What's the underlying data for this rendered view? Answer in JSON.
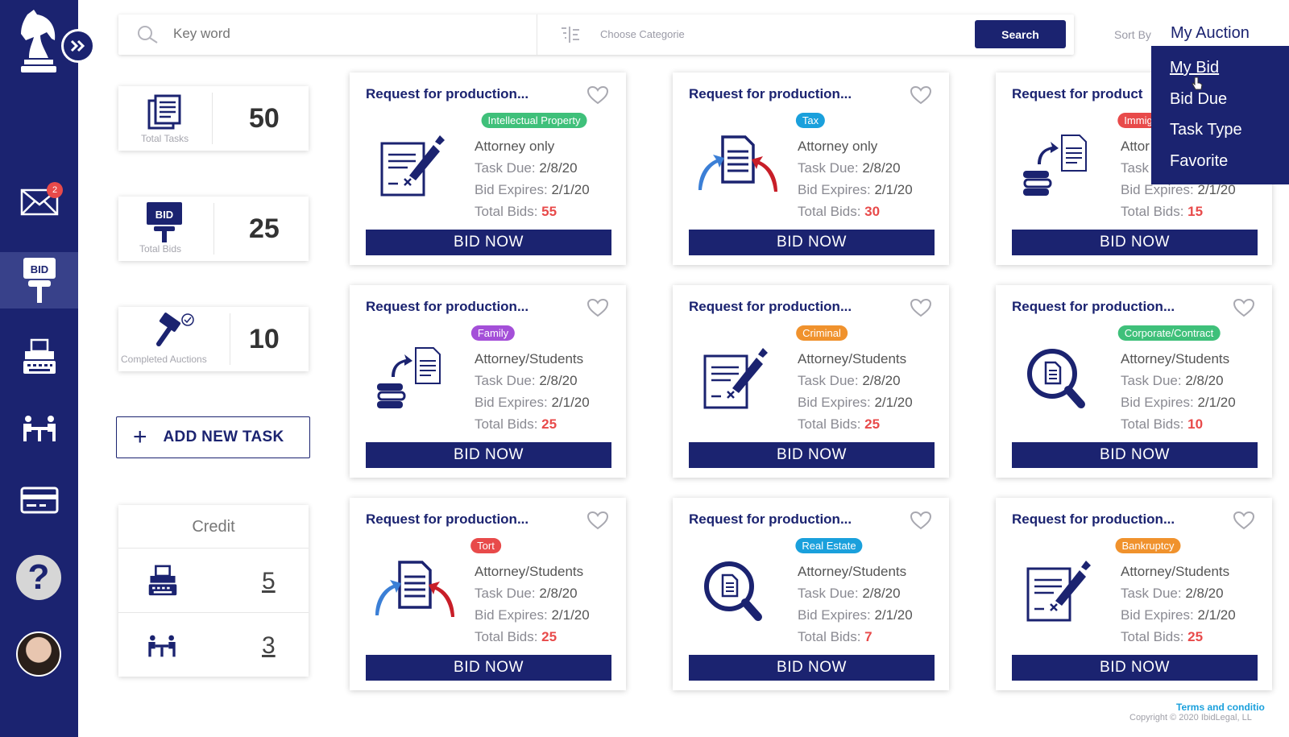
{
  "search": {
    "placeholder": "Key word",
    "category_placeholder": "Choose Categorie",
    "button": "Search"
  },
  "sort": {
    "label": "Sort By",
    "value": "My Auction",
    "options": [
      "My Bid",
      "Bid Due",
      "Task Type",
      "Favorite"
    ]
  },
  "sidebar": {
    "mail_badge": "2",
    "bid_label": "BID"
  },
  "stats": [
    {
      "label": "Total Tasks",
      "value": "50"
    },
    {
      "label": "Total Bids",
      "value": "25",
      "icon_text": "BID"
    },
    {
      "label": "Completed Auctions",
      "value": "10"
    }
  ],
  "add_task": "ADD NEW TASK",
  "credit": {
    "title": "Credit",
    "typewriter_value": "5",
    "meeting_value": "3"
  },
  "cards": [
    {
      "title": "Request for  production...",
      "tag": "Intellectual Property",
      "tag_color": "#3fc07a",
      "icon": "document-sign",
      "audience": "Attorney only",
      "task_due": "2/8/20",
      "bid_expires": "2/1/20",
      "total_bids": "55"
    },
    {
      "title": "Request for  production...",
      "tag": "Tax",
      "tag_color": "#1aa0dc",
      "icon": "document-transfer",
      "audience": "Attorney only",
      "task_due": "2/8/20",
      "bid_expires": "2/1/20",
      "total_bids": "30"
    },
    {
      "title": "Request for  product",
      "tag": "Immig",
      "tag_color": "#e84a4a",
      "icon": "books-document",
      "audience": "Attor",
      "task_due": "",
      "bid_expires": "2/1/20",
      "total_bids": "15"
    },
    {
      "title": "Request for  production...",
      "tag": "Family",
      "tag_color": "#a44fd8",
      "icon": "books-document",
      "audience": "Attorney/Students",
      "task_due": "2/8/20",
      "bid_expires": "2/1/20",
      "total_bids": "25"
    },
    {
      "title": "Request for  production...",
      "tag": "Criminal",
      "tag_color": "#f0922d",
      "icon": "document-sign",
      "audience": "Attorney/Students",
      "task_due": "2/8/20",
      "bid_expires": "2/1/20",
      "total_bids": "25"
    },
    {
      "title": "Request for  production...",
      "tag": "Corporate/Contract",
      "tag_color": "#3fc07a",
      "icon": "magnifier-document",
      "audience": "Attorney/Students",
      "task_due": "2/8/20",
      "bid_expires": "2/1/20",
      "total_bids": "10"
    },
    {
      "title": "Request for  production...",
      "tag": "Tort",
      "tag_color": "#e84a4a",
      "icon": "document-transfer",
      "audience": "Attorney/Students",
      "task_due": "2/8/20",
      "bid_expires": "2/1/20",
      "total_bids": "25"
    },
    {
      "title": "Request for  production...",
      "tag": "Real Estate",
      "tag_color": "#1aa0dc",
      "icon": "magnifier-document",
      "audience": "Attorney/Students",
      "task_due": "2/8/20",
      "bid_expires": "2/1/20",
      "total_bids": "7"
    },
    {
      "title": "Request for  production...",
      "tag": "Bankruptcy",
      "tag_color": "#f0922d",
      "icon": "document-sign",
      "audience": "Attorney/Students",
      "task_due": "2/8/20",
      "bid_expires": "2/1/20",
      "total_bids": "25"
    }
  ],
  "card_labels": {
    "task_due": "Task Due: ",
    "bid_expires": "Bid Expires: ",
    "total_bids": "Total Bids: ",
    "bid_button": "BID NOW",
    "task_due_partial": "Task"
  },
  "footer": {
    "terms": "Terms and conditio",
    "copyright": "Copyright © 2020 IbidLegal, LL"
  }
}
